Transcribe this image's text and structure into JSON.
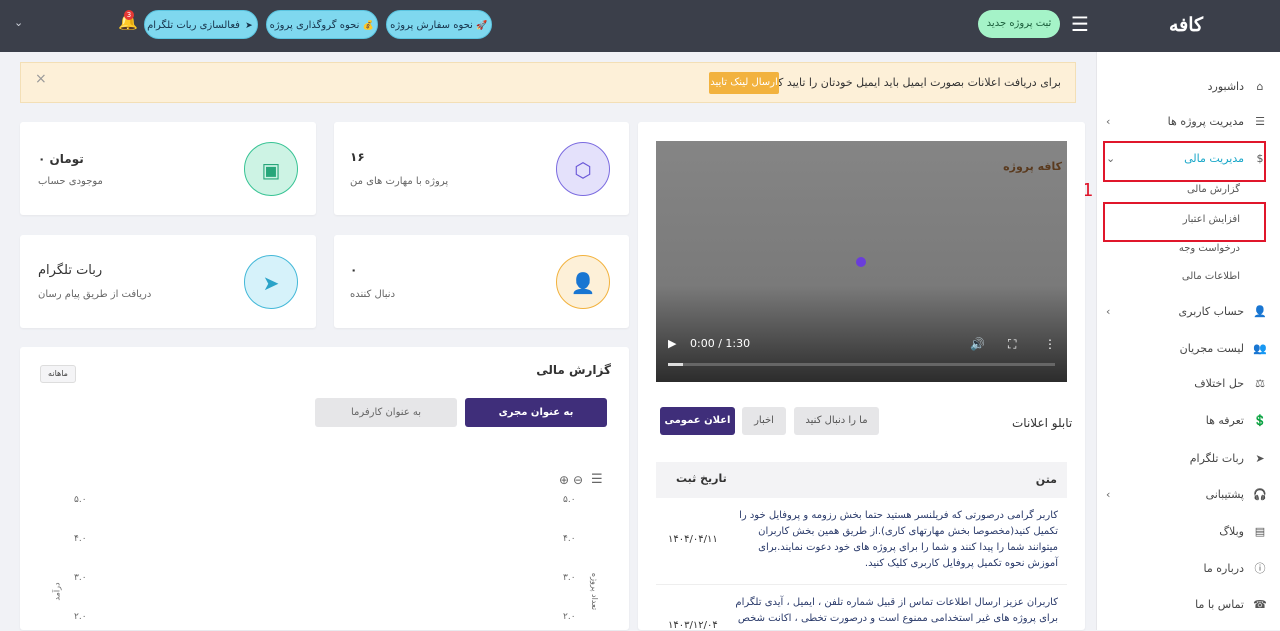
{
  "topbar": {
    "logo": "کافه پروژه",
    "new_project": "ثبت پروژه جدید",
    "pills": [
      {
        "label": "نحوه سفارش پروژه",
        "icon": "rocket-icon"
      },
      {
        "label": "نحوه گروگذاری پروژه",
        "icon": "money-bag-icon"
      },
      {
        "label": "فعالسازی ربات تلگرام",
        "icon": "telegram-icon"
      }
    ],
    "notification_count": "3"
  },
  "sidebar": {
    "items": [
      {
        "label": "داشبورد",
        "icon": "home-icon"
      },
      {
        "label": "مدیریت پروژه ها",
        "icon": "list-icon"
      },
      {
        "label": "مدیریت مالی",
        "icon": "dollar-icon"
      },
      {
        "label": "حساب کاربری",
        "icon": "user-icon"
      },
      {
        "label": "لیست مجریان",
        "icon": "users-icon"
      },
      {
        "label": "حل اختلاف",
        "icon": "scale-icon"
      },
      {
        "label": "تعرفه ها",
        "icon": "money-icon"
      },
      {
        "label": "ربات تلگرام",
        "icon": "send-icon"
      },
      {
        "label": "پشتیبانی",
        "icon": "headset-icon"
      },
      {
        "label": "وبلاگ",
        "icon": "blog-icon"
      },
      {
        "label": "درباره ما",
        "icon": "info-icon"
      },
      {
        "label": "تماس با ما",
        "icon": "phone-icon"
      }
    ],
    "sub_items": [
      "گزارش مالی",
      "افزایش اعتبار",
      "درخواست وجه",
      "اطلاعات مالی"
    ],
    "annotation_number": "1"
  },
  "alert": {
    "text": "برای دریافت اعلانات بصورت ایمیل باید ایمیل خودتان را تایید کنید.",
    "button": "ارسال لینک تایید",
    "close": "×"
  },
  "stats": {
    "balance_value": "۰ تومان",
    "balance_label": "موجودی حساب",
    "projects_value": "۱۶",
    "projects_label": "پروژه با مهارت های من",
    "telegram_title": "ربات تلگرام",
    "telegram_label": "دریافت از طریق پیام رسان",
    "followers_value": "۰",
    "followers_label": "دنبال کننده"
  },
  "finance": {
    "title": "گزارش مالی",
    "period": "ماهانه",
    "tab_contractor": "به عنوان مجری",
    "tab_employer": "به عنوان کارفرما",
    "y_left_label": "درآمد",
    "y_right_label": "تعداد پروژه",
    "ticks": [
      "۵.۰",
      "۴.۰",
      "۳.۰",
      "۲.۰"
    ]
  },
  "video": {
    "time": "0:00 / 1:30",
    "watermark": "کافه پروژه",
    "progress": 0.04
  },
  "board": {
    "title": "تابلو اعلانات",
    "tab_public": "اعلان عمومی",
    "tab_news": "اخبار",
    "tab_follow": "ما را دنبال کنید",
    "col_text": "متن",
    "col_date": "تاریخ ثبت",
    "rows": [
      {
        "text": "کاربر گرامی درصورتی که فریلنسر هستید حتما بخش رزومه و پروفایل خود را تکمیل کنید(مخصوصا بخش مهارتهای کاری).از طریق همین بخش کاربران میتوانند شما را پیدا کنند و شما را برای پروژه های خود دعوت نمایند.برای آموزش نحوه تکمیل پروفایل کاربری کلیک کنید.",
        "date": "۱۴۰۴/۰۴/۱۱"
      },
      {
        "text": "کاربران عزیز ارسال اطلاعات تماس از قبیل شماره تلفن ، ایمیل ، آیدی تلگرام برای پروژه های غیر استخدامی ممنوع است و درصورت تخطی ، اکانت شخص",
        "date": "۱۴۰۳/۱۲/۰۴"
      }
    ]
  }
}
